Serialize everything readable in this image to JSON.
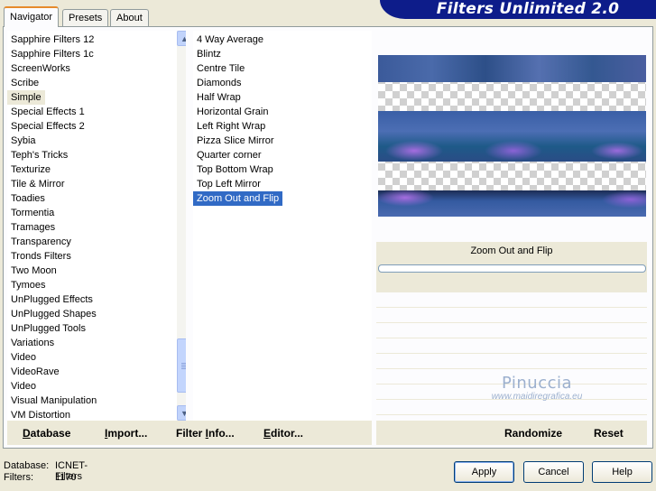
{
  "app": {
    "title": "Filters Unlimited 2.0",
    "tabs": [
      {
        "label": "Navigator",
        "active": true
      },
      {
        "label": "Presets",
        "active": false
      },
      {
        "label": "About",
        "active": false
      }
    ]
  },
  "categories": {
    "items": [
      "Sapphire Filters 12",
      "Sapphire Filters 1c",
      "ScreenWorks",
      "Scribe",
      "Simple",
      "Special Effects 1",
      "Special Effects 2",
      "Sybia",
      "Teph's Tricks",
      "Texturize",
      "Tile & Mirror",
      "Toadies",
      "Tormentia",
      "Tramages",
      "Transparency",
      "Tronds Filters",
      "Two Moon",
      "Tymoes",
      "UnPlugged Effects",
      "UnPlugged Shapes",
      "UnPlugged Tools",
      "Variations",
      "Video",
      "VideoRave",
      "Video",
      "Visual Manipulation",
      "VM Distortion"
    ],
    "selected": "Simple"
  },
  "filters": {
    "items": [
      "4 Way Average",
      "Blintz",
      "Centre Tile",
      "Diamonds",
      "Half Wrap",
      "Horizontal Grain",
      "Left Right Wrap",
      "Pizza Slice Mirror",
      "Quarter corner",
      "Top Bottom Wrap",
      "Top Left Mirror",
      "Zoom Out and Flip"
    ],
    "selected": "Zoom Out and Flip"
  },
  "preview": {
    "filter_name": "Zoom Out and Flip"
  },
  "watermark": {
    "name": "Pinuccia",
    "url": "www.maidiregrafica.eu"
  },
  "left_toolbar": {
    "database": {
      "first": "D",
      "rest": "atabase"
    },
    "import": {
      "first": "I",
      "rest": "mport..."
    },
    "filter_info": {
      "pre": "Filter ",
      "first": "I",
      "rest": "nfo..."
    },
    "editor": {
      "first": "E",
      "rest": "ditor..."
    }
  },
  "right_toolbar": {
    "randomize": "Randomize",
    "reset": "Reset"
  },
  "info": {
    "database_label": "Database:",
    "database_value": "ICNET-Filters",
    "filters_label": "Filters:",
    "filters_value": "1170"
  },
  "buttons": {
    "apply": "Apply",
    "cancel": "Cancel",
    "help": "Help"
  }
}
